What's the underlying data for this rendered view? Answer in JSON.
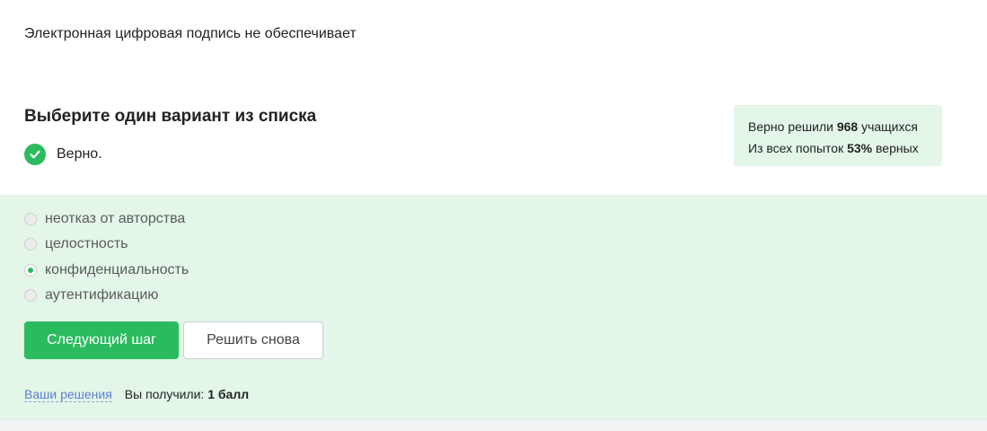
{
  "question": {
    "text": "Электронная цифровая подпись не обеспечивает"
  },
  "instruction": "Выберите один вариант из списка",
  "verdict": {
    "icon": "check-circle-icon",
    "text": "Верно.",
    "color": "#2bbb5f"
  },
  "stats": {
    "line1_prefix": "Верно решили ",
    "solved_count": "968",
    "line1_suffix": " учащихся",
    "line2_prefix": "Из всех попыток ",
    "correct_percent": "53%",
    "line2_suffix": " верных"
  },
  "options": [
    {
      "label": "неотказ от авторства",
      "selected": false
    },
    {
      "label": "целостность",
      "selected": false
    },
    {
      "label": "конфиденциальность",
      "selected": true
    },
    {
      "label": "аутентификацию",
      "selected": false
    }
  ],
  "buttons": {
    "next_label": "Следующий шаг",
    "retry_label": "Решить снова"
  },
  "footer": {
    "solutions_link": "Ваши решения",
    "score_prefix": "Вы получили:",
    "score_value": "1 балл"
  },
  "colors": {
    "accent": "#2bbb5f",
    "success_bg": "#e3f6e8",
    "link": "#5a7fcf"
  }
}
